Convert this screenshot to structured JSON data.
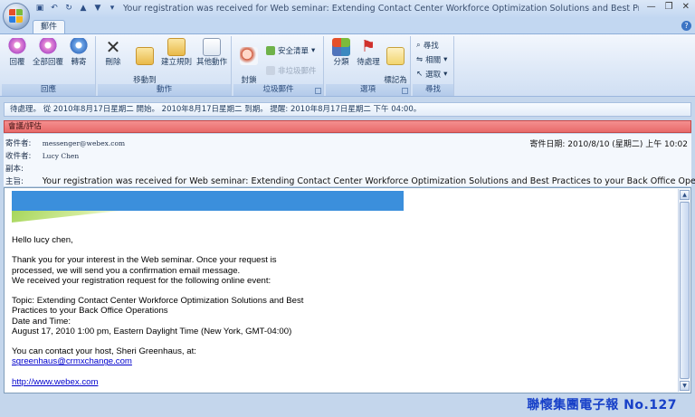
{
  "window": {
    "title": "Your registration was received for Web seminar: Extending Contact Center Workforce Optimization Solutions and Best Practices to you..."
  },
  "tabs": [
    {
      "label": "郵件"
    }
  ],
  "ribbon": {
    "groups": [
      {
        "label": "回應",
        "buttons": [
          "回覆",
          "全部回覆",
          "轉寄"
        ]
      },
      {
        "label": "動作",
        "buttons": [
          "刪除",
          "移動到\n資料夾",
          "建立規則",
          "其他動作"
        ]
      },
      {
        "label": "垃圾郵件",
        "buttons": [
          "封鎖\n寄件者"
        ],
        "small": [
          "安全清單",
          "非垃圾郵件"
        ]
      },
      {
        "label": "選項",
        "buttons": [
          "分類",
          "待處理",
          "標記為\n未讀取"
        ]
      },
      {
        "label": "尋找",
        "small": [
          "尋找",
          "相關",
          "選取"
        ]
      }
    ]
  },
  "infobar": {
    "text": "待處理。 從 2010年8月17日星期二 開始。 2010年8月17日星期二 到期。 提醒: 2010年8月17日星期二 下午 04:00。"
  },
  "flagbar": {
    "text": "會議/評估"
  },
  "header": {
    "from_label": "寄件者:",
    "from_value": "messenger@webex.com",
    "to_label": "收件者:",
    "to_value": "Lucy Chen",
    "cc_label": "副本:",
    "cc_value": "",
    "subject_label": "主旨:",
    "subject_value": "Your registration was received for Web seminar: Extending Contact Center Workforce Optimization Solutions and Best Practices to your Back Office Operations",
    "sent_label": "寄件日期:",
    "sent_value": "2010/8/10 (星期二) 上午 10:02"
  },
  "body": {
    "greeting": "Hello lucy chen,",
    "p1_l1": "Thank you for your interest in the Web seminar. Once your request is",
    "p1_l2": "processed, we will send you a confirmation email message.",
    "p1_l3": "We received your registration request for the following online event:",
    "topic_l1": "Topic: Extending Contact Center Workforce Optimization Solutions and Best",
    "topic_l2": "Practices to your Back Office Operations",
    "date_label": "Date and Time:",
    "date_value": "August 17, 2010 1:00 pm, Eastern Daylight Time (New York, GMT-04:00)",
    "contact": "You can contact your host, Sheri Greenhaus, at:",
    "contact_email": "sgreenhaus@crmxchange.com",
    "webex_link": "http://www.webex.com"
  },
  "footer": {
    "text": "聯懷集團電子報  No.127"
  }
}
